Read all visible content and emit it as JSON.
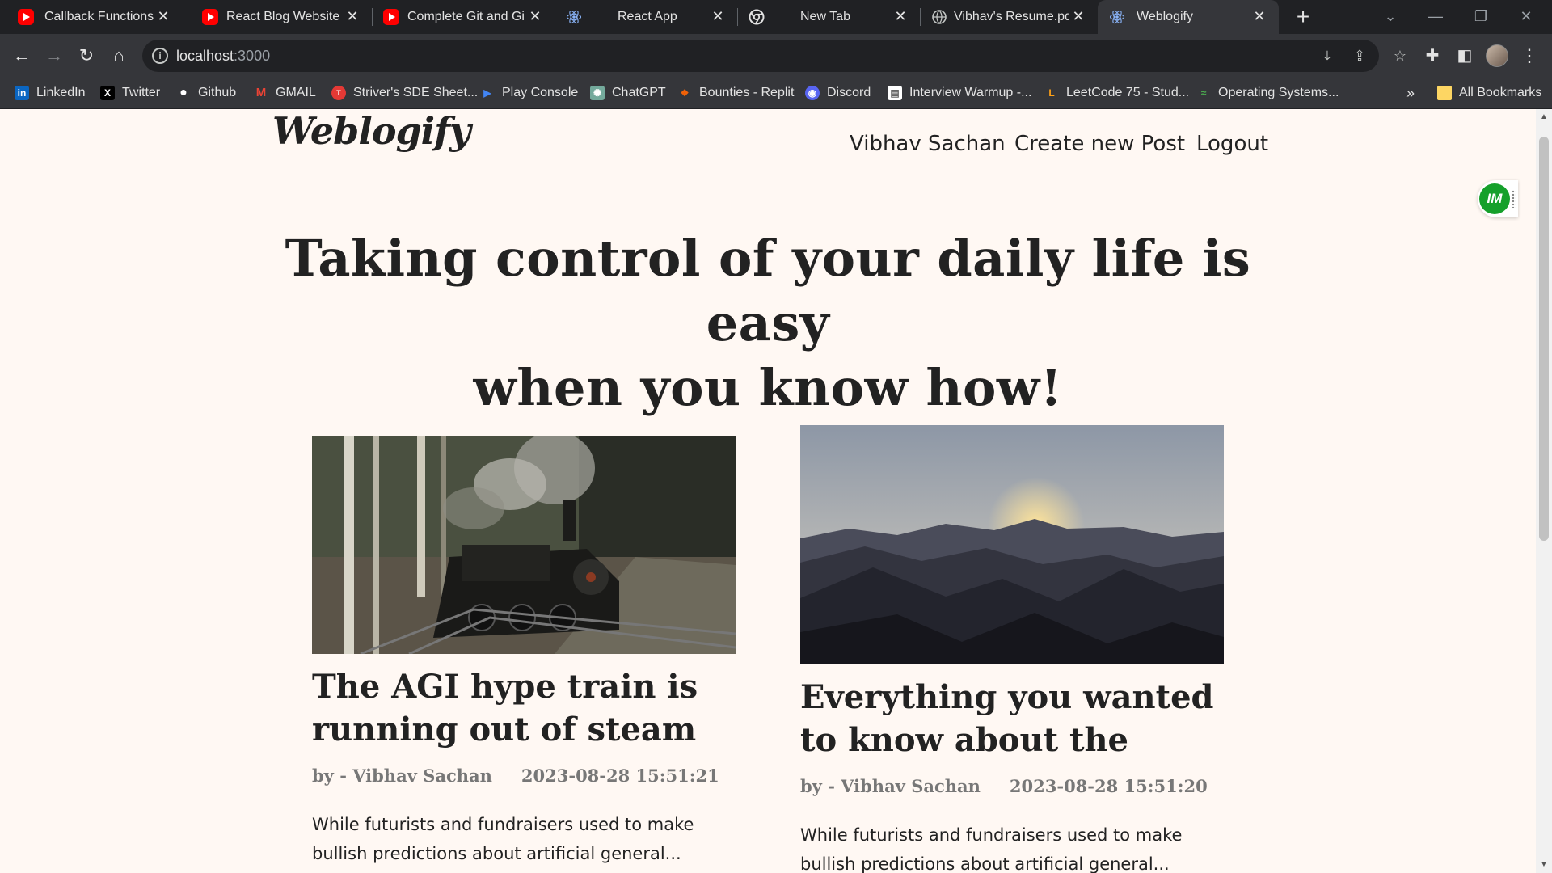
{
  "browser": {
    "tabs": [
      {
        "title": "Callback Functions in",
        "favicon": "youtube-icon"
      },
      {
        "title": "React Blog Website D",
        "favicon": "youtube-icon"
      },
      {
        "title": "Complete Git and Git",
        "favicon": "youtube-icon"
      },
      {
        "title": "React App",
        "favicon": "react-icon"
      },
      {
        "title": "New Tab",
        "favicon": "chrome-icon"
      },
      {
        "title": "Vibhav's Resume.pdf",
        "favicon": "globe-icon"
      },
      {
        "title": "Weblogify",
        "favicon": "react-icon",
        "active": true
      }
    ],
    "close_glyph": "✕",
    "new_tab_glyph": "+",
    "url_host": "localhost",
    "url_port": ":3000",
    "bookmarks": [
      {
        "label": "LinkedIn",
        "icon": "linkedin-icon",
        "color": "#0a66c2",
        "glyph": "in"
      },
      {
        "label": "Twitter",
        "icon": "x-icon",
        "color": "#000000",
        "glyph": "X"
      },
      {
        "label": "Github",
        "icon": "github-icon",
        "color": "#ffffff",
        "glyph": "●"
      },
      {
        "label": "GMAIL",
        "icon": "gmail-icon",
        "color": "#ea4335",
        "glyph": "M"
      },
      {
        "label": "Striver's SDE Sheet...",
        "icon": "tuf-icon",
        "color": "#e53935",
        "glyph": "T"
      },
      {
        "label": "Play Console",
        "icon": "play-console-icon",
        "color": "#4285f4",
        "glyph": "▶"
      },
      {
        "label": "ChatGPT",
        "icon": "chatgpt-icon",
        "color": "#74aa9c",
        "glyph": "✺"
      },
      {
        "label": "Bounties - Replit",
        "icon": "replit-icon",
        "color": "#f26207",
        "glyph": "❖"
      },
      {
        "label": "Discord",
        "icon": "discord-icon",
        "color": "#5865f2",
        "glyph": "◉"
      },
      {
        "label": "Interview Warmup -...",
        "icon": "interview-warmup-icon",
        "color": "#ffffff",
        "glyph": "▤"
      },
      {
        "label": "LeetCode 75 - Stud...",
        "icon": "leetcode-icon",
        "color": "#ffa116",
        "glyph": "L"
      },
      {
        "label": "Operating Systems...",
        "icon": "os-icon",
        "color": "#2e7d32",
        "glyph": "≈"
      }
    ],
    "bookmarks_overflow": "»",
    "all_bookmarks": "All Bookmarks"
  },
  "site": {
    "logo": "Weblogify",
    "nav": {
      "user": "Vibhav Sachan",
      "create": "Create new Post",
      "logout": "Logout"
    },
    "hero_line1": "Taking control of your daily life is easy",
    "hero_line2": "when you know how!",
    "posts": [
      {
        "title": "The AGI hype train is running out of steam edit...",
        "author": "by - Vibhav Sachan",
        "date": "2023-08-28 15:51:21",
        "excerpt": "While futurists and fundraisers used to make bullish predictions about artificial general...",
        "image": "steam-train-photo"
      },
      {
        "title": "Everything you wanted to know about the metavers...",
        "author": "by - Vibhav Sachan",
        "date": "2023-08-28 15:51:20",
        "excerpt": "While futurists and fundraisers used to make bullish predictions about artificial general...",
        "image": "mountain-sunset-photo"
      }
    ],
    "extension_badge": "IM"
  }
}
